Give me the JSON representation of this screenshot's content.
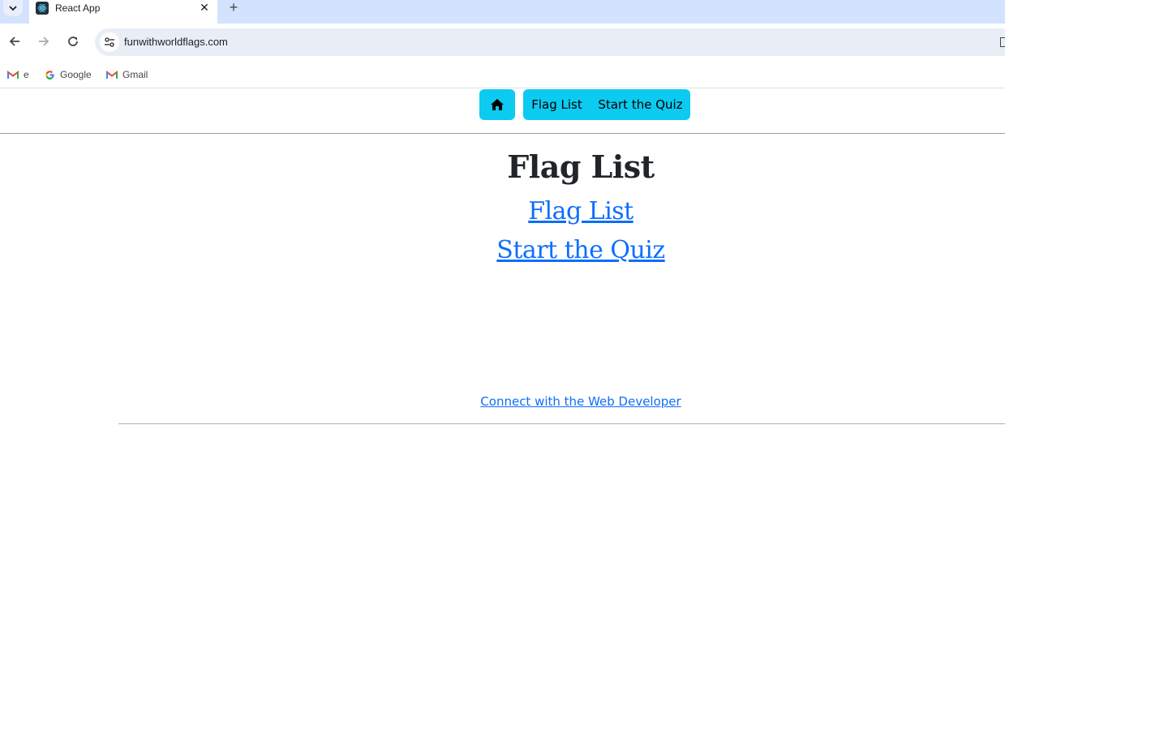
{
  "browser": {
    "tab_title": "React App",
    "url": "funwithworldflags.com",
    "bookmarks": [
      {
        "label": "e",
        "icon": "gmail-icon"
      },
      {
        "label": "Google",
        "icon": "google-icon"
      },
      {
        "label": "Gmail",
        "icon": "gmail-icon"
      }
    ]
  },
  "nav": {
    "home_icon": "home-icon",
    "flag_list": "Flag List",
    "start_quiz": "Start the Quiz",
    "accent": "#0dcaf0"
  },
  "main": {
    "heading": "Flag List",
    "links": [
      "Flag List",
      "Start the Quiz"
    ],
    "link_color": "#0d6efd"
  },
  "footer": {
    "connect": "Connect with the Web Developer"
  }
}
